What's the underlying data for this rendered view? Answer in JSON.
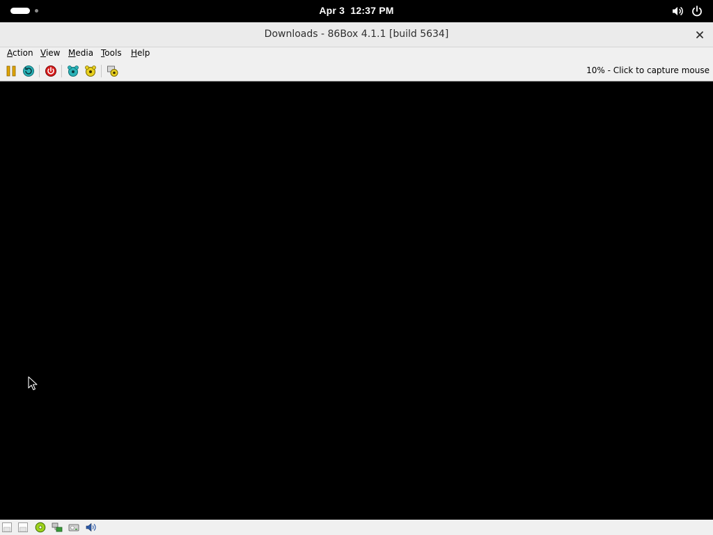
{
  "topbar": {
    "date": "Apr 3",
    "time": "12:37 PM",
    "icons": [
      "activities-indicator",
      "volume-icon",
      "power-icon"
    ]
  },
  "window": {
    "title": "Downloads - 86Box 4.1.1 [build 5634]",
    "close_icon": "close-icon"
  },
  "menubar": {
    "items": [
      {
        "label": "Action",
        "mnemonic": "A",
        "rest": "ction"
      },
      {
        "label": "View",
        "mnemonic": "V",
        "rest": "iew"
      },
      {
        "label": "Media",
        "mnemonic": "M",
        "rest": "edia"
      },
      {
        "label": "Tools",
        "mnemonic": "T",
        "rest": "ools"
      },
      {
        "label": "Help",
        "mnemonic": "H",
        "rest": "elp"
      }
    ]
  },
  "toolbar": {
    "buttons": [
      "pause-icon",
      "ctrl-alt-del-icon",
      "hard-reset-icon",
      "ctrl-alt-esc-icon",
      "settings-icon",
      "screenshot-icon"
    ],
    "status_text": "10% - Click to capture mouse"
  },
  "statusbar": {
    "icons": [
      "floppy-drive-1-icon",
      "floppy-drive-2-icon",
      "cdrom-icon",
      "network-icon",
      "hard-disk-icon",
      "sound-icon"
    ]
  },
  "colors": {
    "topbar_bg": "#000000",
    "titlebar_bg": "#ebebeb",
    "menubar_bg": "#f0f0f0",
    "screen_bg": "#000000"
  }
}
